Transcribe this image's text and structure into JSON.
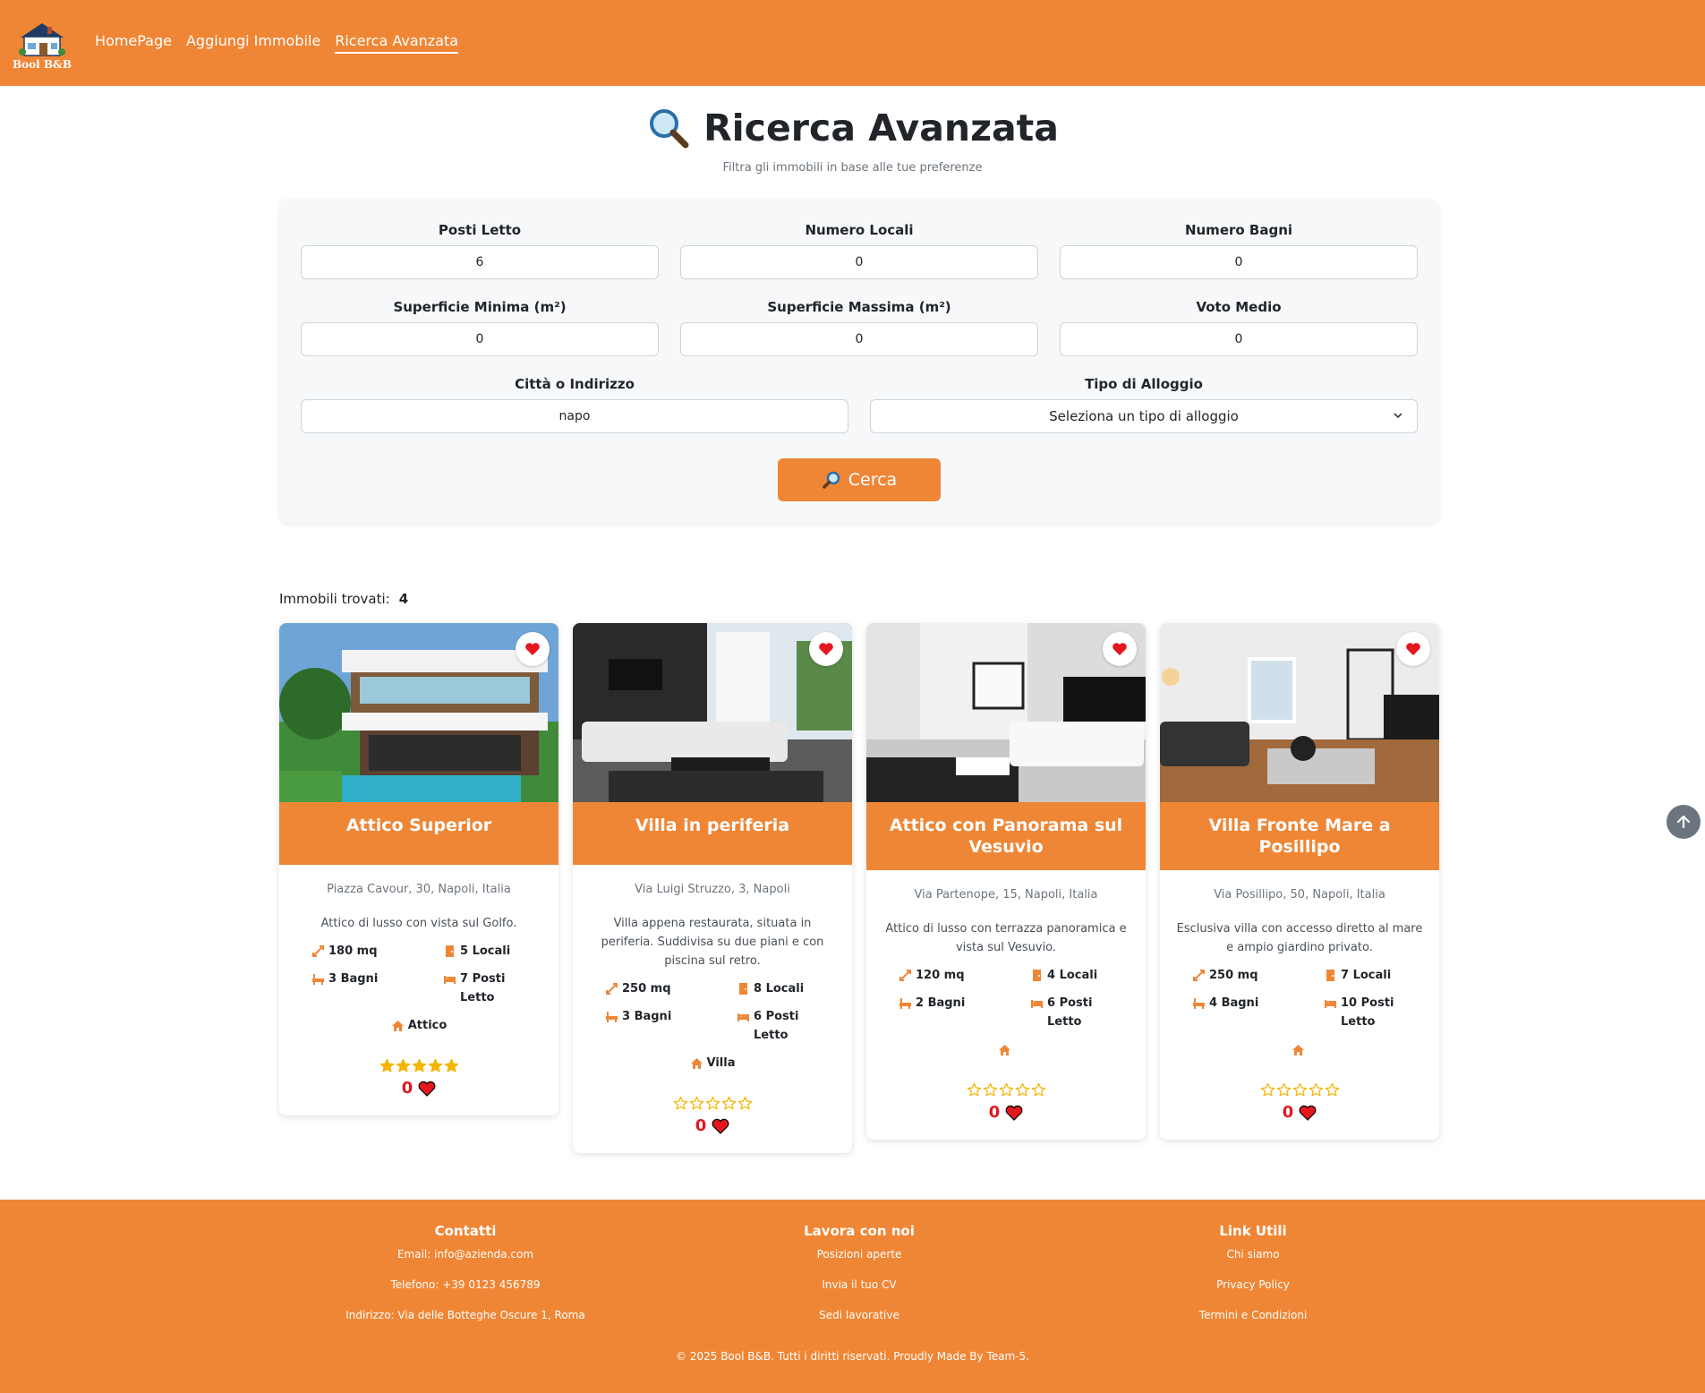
{
  "brand": {
    "name": "Bool B&B"
  },
  "nav": [
    {
      "label": "HomePage",
      "active": false
    },
    {
      "label": "Aggiungi Immobile",
      "active": false
    },
    {
      "label": "Ricerca Avanzata",
      "active": true
    }
  ],
  "header": {
    "title": "Ricerca Avanzata",
    "subtitle": "Filtra gli immobili in base alle tue preferenze"
  },
  "form": {
    "posti_letto": {
      "label": "Posti Letto",
      "value": "6"
    },
    "numero_locali": {
      "label": "Numero Locali",
      "value": "0"
    },
    "numero_bagni": {
      "label": "Numero Bagni",
      "value": "0"
    },
    "superficie_min": {
      "label": "Superficie Minima (m²)",
      "value": "0"
    },
    "superficie_max": {
      "label": "Superficie Massima (m²)",
      "value": "0"
    },
    "voto_medio": {
      "label": "Voto Medio",
      "value": "0"
    },
    "citta": {
      "label": "Città o Indirizzo",
      "value": "napo"
    },
    "tipo": {
      "label": "Tipo di Alloggio",
      "selected": "Seleziona un tipo di alloggio"
    },
    "search_label": "Cerca"
  },
  "results": {
    "label": "Immobili trovati:",
    "count": "4",
    "items": [
      {
        "title": "Attico Superior",
        "address": "Piazza Cavour, 30, Napoli, Italia",
        "description": "Attico di lusso con vista sul Golfo.",
        "mq": "180 mq",
        "locali": "5 Locali",
        "bagni": "3 Bagni",
        "posti": "7 Posti Letto",
        "type": "Attico",
        "rating": 5,
        "likes": "0"
      },
      {
        "title": "Villa in periferia",
        "address": "Via Luigi Struzzo, 3, Napoli",
        "description": "Villa appena restaurata, situata in periferia. Suddivisa su due piani e con piscina sul retro.",
        "mq": "250 mq",
        "locali": "8 Locali",
        "bagni": "3 Bagni",
        "posti": "6 Posti Letto",
        "type": "Villa",
        "rating": 0,
        "likes": "0"
      },
      {
        "title": "Attico con Panorama sul Vesuvio",
        "address": "Via Partenope, 15, Napoli, Italia",
        "description": "Attico di lusso con terrazza panoramica e vista sul Vesuvio.",
        "mq": "120 mq",
        "locali": "4 Locali",
        "bagni": "2 Bagni",
        "posti": "6 Posti Letto",
        "type": "",
        "rating": 0,
        "likes": "0"
      },
      {
        "title": "Villa Fronte Mare a Posillipo",
        "address": "Via Posillipo, 50, Napoli, Italia",
        "description": "Esclusiva villa con accesso diretto al mare e ampio giardino privato.",
        "mq": "250 mq",
        "locali": "7 Locali",
        "bagni": "4 Bagni",
        "posti": "10 Posti Letto",
        "type": "",
        "rating": 0,
        "likes": "0"
      }
    ]
  },
  "footer": {
    "contatti": {
      "title": "Contatti",
      "email": "Email: info@azienda.com",
      "telefono": "Telefono: +39 0123 456789",
      "indirizzo": "Indirizzo: Via delle Botteghe Oscure 1, Roma"
    },
    "lavora": {
      "title": "Lavora con noi",
      "links": [
        "Posizioni aperte",
        "Invia il tuo CV",
        "Sedi lavorative"
      ]
    },
    "utili": {
      "title": "Link Utili",
      "links": [
        "Chi siamo",
        "Privacy Policy",
        "Termini e Condizioni"
      ]
    },
    "copyright": "© 2025 Bool B&B. Tutti i diritti riservati. Proudly Made By Team-5."
  },
  "colors": {
    "accent": "#ef8635",
    "heart": "#e4171f",
    "star": "#f5b400"
  },
  "icons": [
    "house-logo-icon",
    "magnifier-icon",
    "chevron-down-icon",
    "heart-icon",
    "resize-icon",
    "door-icon",
    "bath-icon",
    "bed-icon",
    "home-icon",
    "star-icon",
    "arrow-up-icon"
  ]
}
